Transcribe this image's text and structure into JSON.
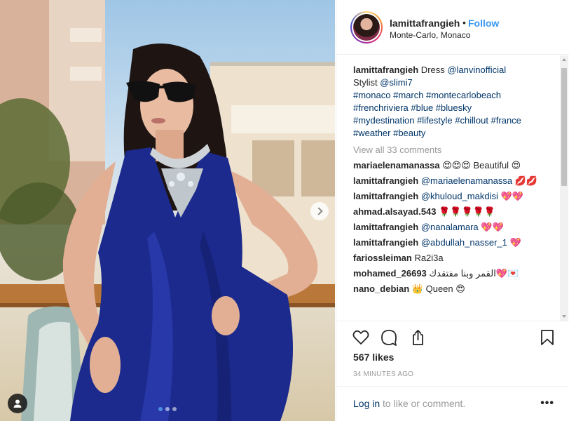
{
  "post": {
    "username": "lamittafrangieh",
    "follow_label": "Follow",
    "separator": "•",
    "location": "Monte-Carlo, Monaco",
    "caption": {
      "username": "lamittafrangieh",
      "text_1": " Dress ",
      "mention_1": "@lanvinofficial",
      "text_2": "Stylist ",
      "mention_2": "@slimi7",
      "hashtags_line_1": "#monaco #march #montecarlobeach",
      "hashtags_line_2": "#frenchriviera #blue #bluesky",
      "hashtags_line_3": "#mydestination #lifestyle #chillout #france",
      "hashtags_line_4": "#weather #beauty"
    },
    "view_all_comments": "View all 33 comments",
    "comments": [
      {
        "user": "mariaelenamanassa",
        "mention": "",
        "text": " 😍😍😍 Beautiful 😍"
      },
      {
        "user": "lamittafrangieh",
        "mention": "@mariaelenamanassa",
        "text": " 💋💋"
      },
      {
        "user": "lamittafrangieh",
        "mention": "@khuloud_makdisi",
        "text": " 💖💖"
      },
      {
        "user": "ahmad.alsayad.543",
        "mention": "",
        "text": " 🌹🌹🌹🌹🌹"
      },
      {
        "user": "lamittafrangieh",
        "mention": "@nanalamara",
        "text": " 💖💖"
      },
      {
        "user": "lamittafrangieh",
        "mention": "@abdullah_nasser_1",
        "text": " 💖"
      },
      {
        "user": "fariossleiman",
        "mention": "",
        "text": " Ra2i3a"
      },
      {
        "user": "mohamed_26693",
        "mention": "",
        "text": " القمر وبنا مفتقدك💖💌"
      },
      {
        "user": "nano_debian",
        "mention": "",
        "text": " 👑 Queen 😍"
      }
    ],
    "likes": "567 likes",
    "timestamp": "34 MINUTES AGO",
    "login_link": "Log in",
    "login_text": " to like or comment.",
    "more_label": "•••",
    "carousel": {
      "slides": 3,
      "active": 0
    },
    "icons": {
      "like": "heart-icon",
      "comment": "comment-icon",
      "share": "share-icon",
      "save": "bookmark-icon",
      "next": "chevron-right-icon",
      "tag": "user-tag-icon"
    },
    "colors": {
      "link": "#003569",
      "follow": "#3897f0",
      "muted": "#999999",
      "dress": "#1b2a8c"
    }
  }
}
